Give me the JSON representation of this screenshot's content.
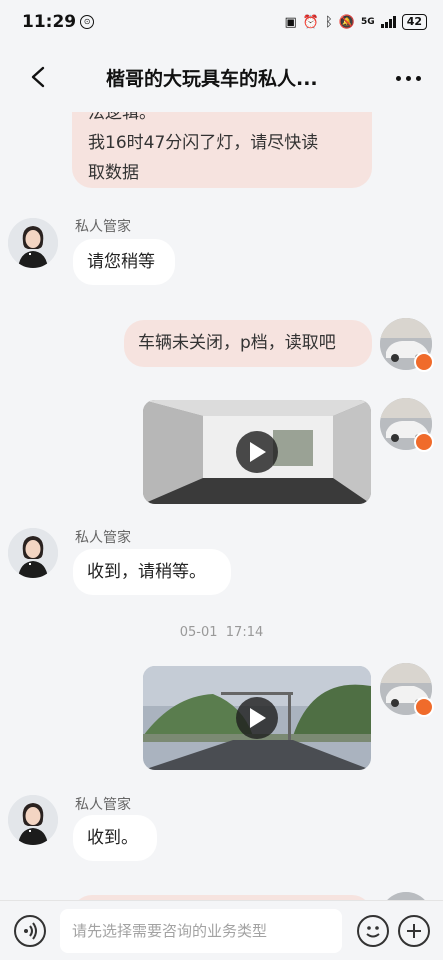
{
  "status_bar": {
    "time": "11:29",
    "network": "5G",
    "battery": "42"
  },
  "header": {
    "title": "楷哥的大玩具车的私人..."
  },
  "messages": {
    "top_user_text_line1": "法逻辑。",
    "top_user_text_line2": "我16时47分闪了灯，请尽快读",
    "top_user_text_line3": "取数据",
    "agent1_name": "私人管家",
    "agent1_text": "请您稍等",
    "user2_text": "车辆未关闭，p档，读取吧",
    "agent2_name": "私人管家",
    "agent2_text": "收到，请稍等。",
    "timestamp": "05-01  17:14",
    "agent3_name": "私人管家",
    "agent3_text": "收到。"
  },
  "input": {
    "placeholder": "请先选择需要咨询的业务类型"
  },
  "colors": {
    "user_bubble": "#f6e3df",
    "agent_bubble": "#ffffff",
    "background": "#f4f5f7",
    "badge": "#f06b2b"
  }
}
